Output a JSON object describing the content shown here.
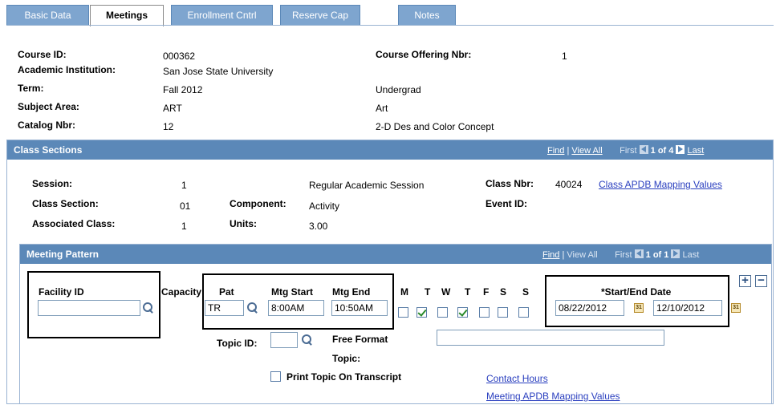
{
  "tabs": [
    {
      "label": "Basic Data"
    },
    {
      "label": "Meetings"
    },
    {
      "label": "Enrollment Cntrl"
    },
    {
      "label": "Reserve Cap"
    },
    {
      "label": "Notes"
    }
  ],
  "course": {
    "course_id_label": "Course ID:",
    "course_id": "000362",
    "offering_label": "Course Offering Nbr:",
    "offering": "1",
    "institution_label": "Academic Institution:",
    "institution": "San Jose State University",
    "term_label": "Term:",
    "term": "Fall 2012",
    "career": "Undergrad",
    "subject_label": "Subject Area:",
    "subject": "ART",
    "subject_desc": "Art",
    "catalog_label": "Catalog Nbr:",
    "catalog": "12",
    "catalog_desc": "2-D Des and Color Concept"
  },
  "class_sections": {
    "title": "Class Sections",
    "find": "Find",
    "view_all": "View All",
    "first": "First",
    "count": "1 of 4",
    "last": "Last",
    "session_label": "Session:",
    "session": "1",
    "session_desc": "Regular Academic Session",
    "class_nbr_label": "Class Nbr:",
    "class_nbr": "40024",
    "apdb_link": "Class APDB Mapping Values",
    "section_label": "Class Section:",
    "section": "01",
    "component_label": "Component:",
    "component": "Activity",
    "event_label": "Event ID:",
    "assoc_label": "Associated Class:",
    "assoc": "1",
    "units_label": "Units:",
    "units": "3.00"
  },
  "meeting_pattern": {
    "title": "Meeting Pattern",
    "find": "Find",
    "view_all": "View All",
    "first": "First",
    "count": "1 of 1",
    "last": "Last",
    "facility_label": "Facility ID",
    "facility_value": "",
    "capacity_label": "Capacity",
    "pat_label": "Pat",
    "pat_value": "TR",
    "start_label": "Mtg Start",
    "start_value": "8:00AM",
    "end_label": "Mtg End",
    "end_value": "10:50AM",
    "days": [
      {
        "label": "M",
        "checked": false
      },
      {
        "label": "T",
        "checked": true
      },
      {
        "label": "W",
        "checked": false
      },
      {
        "label": "T",
        "checked": true
      },
      {
        "label": "F",
        "checked": false
      },
      {
        "label": "S",
        "checked": false
      },
      {
        "label": "S",
        "checked": false
      }
    ],
    "date_label": "*Start/End Date",
    "start_date": "08/22/2012",
    "end_date": "12/10/2012",
    "calendar_icon_text": "31",
    "topic_label": "Topic ID:",
    "free_format_label_1": "Free Format",
    "free_format_label_2": "Topic:",
    "print_topic_label": "Print Topic On Transcript",
    "contact_hours_link": "Contact Hours",
    "meeting_apdb_link": "Meeting APDB Mapping Values"
  }
}
